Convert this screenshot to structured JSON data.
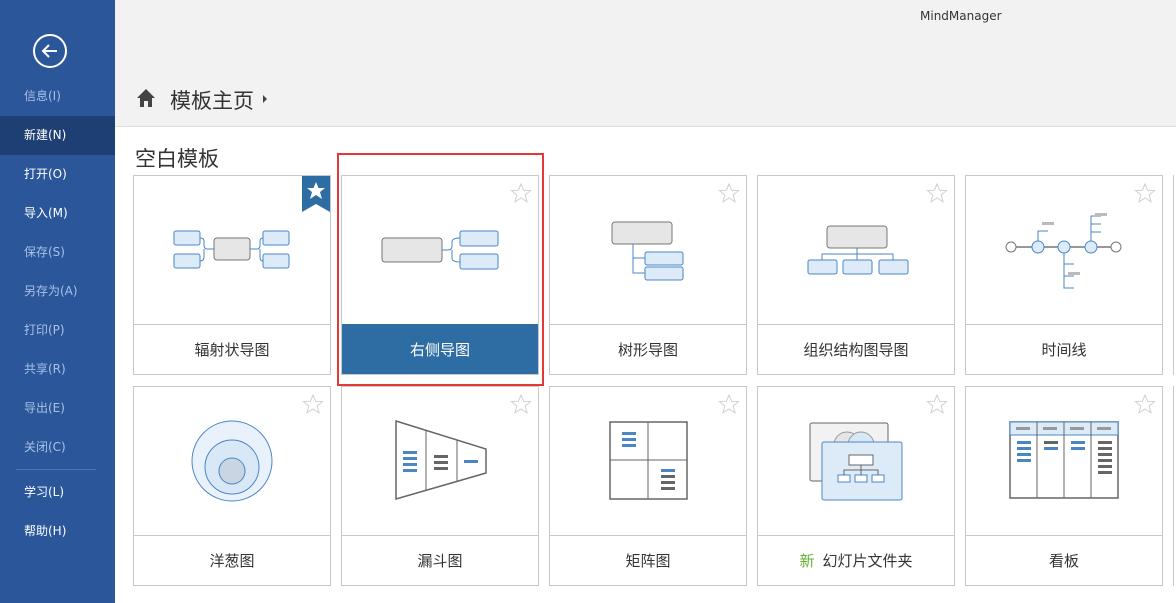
{
  "app": {
    "title": "MindManager"
  },
  "sidebar": {
    "items": [
      {
        "label": "信息(I)"
      },
      {
        "label": "新建(N)"
      },
      {
        "label": "打开(O)"
      },
      {
        "label": "导入(M)"
      },
      {
        "label": "保存(S)"
      },
      {
        "label": "另存为(A)"
      },
      {
        "label": "打印(P)"
      },
      {
        "label": "共享(R)"
      },
      {
        "label": "导出(E)"
      },
      {
        "label": "关闭(C)"
      },
      {
        "label": "学习(L)"
      },
      {
        "label": "帮助(H)"
      }
    ]
  },
  "breadcrumb": {
    "label": "模板主页"
  },
  "section": {
    "title": "空白模板"
  },
  "templates": [
    {
      "label": "辐射状导图",
      "icon": "radial-map-icon",
      "favorite": true
    },
    {
      "label": "右侧导图",
      "icon": "right-map-icon",
      "selected": true
    },
    {
      "label": "树形导图",
      "icon": "tree-map-icon"
    },
    {
      "label": "组织结构图导图",
      "icon": "org-chart-icon"
    },
    {
      "label": "时间线",
      "icon": "timeline-icon"
    },
    {
      "label": "洋葱图",
      "icon": "onion-diagram-icon"
    },
    {
      "label": "漏斗图",
      "icon": "funnel-diagram-icon"
    },
    {
      "label": "矩阵图",
      "icon": "matrix-diagram-icon"
    },
    {
      "new_tag": "新",
      "label": "幻灯片文件夹",
      "icon": "slide-folder-icon"
    },
    {
      "label": "看板",
      "icon": "kanban-icon"
    }
  ]
}
